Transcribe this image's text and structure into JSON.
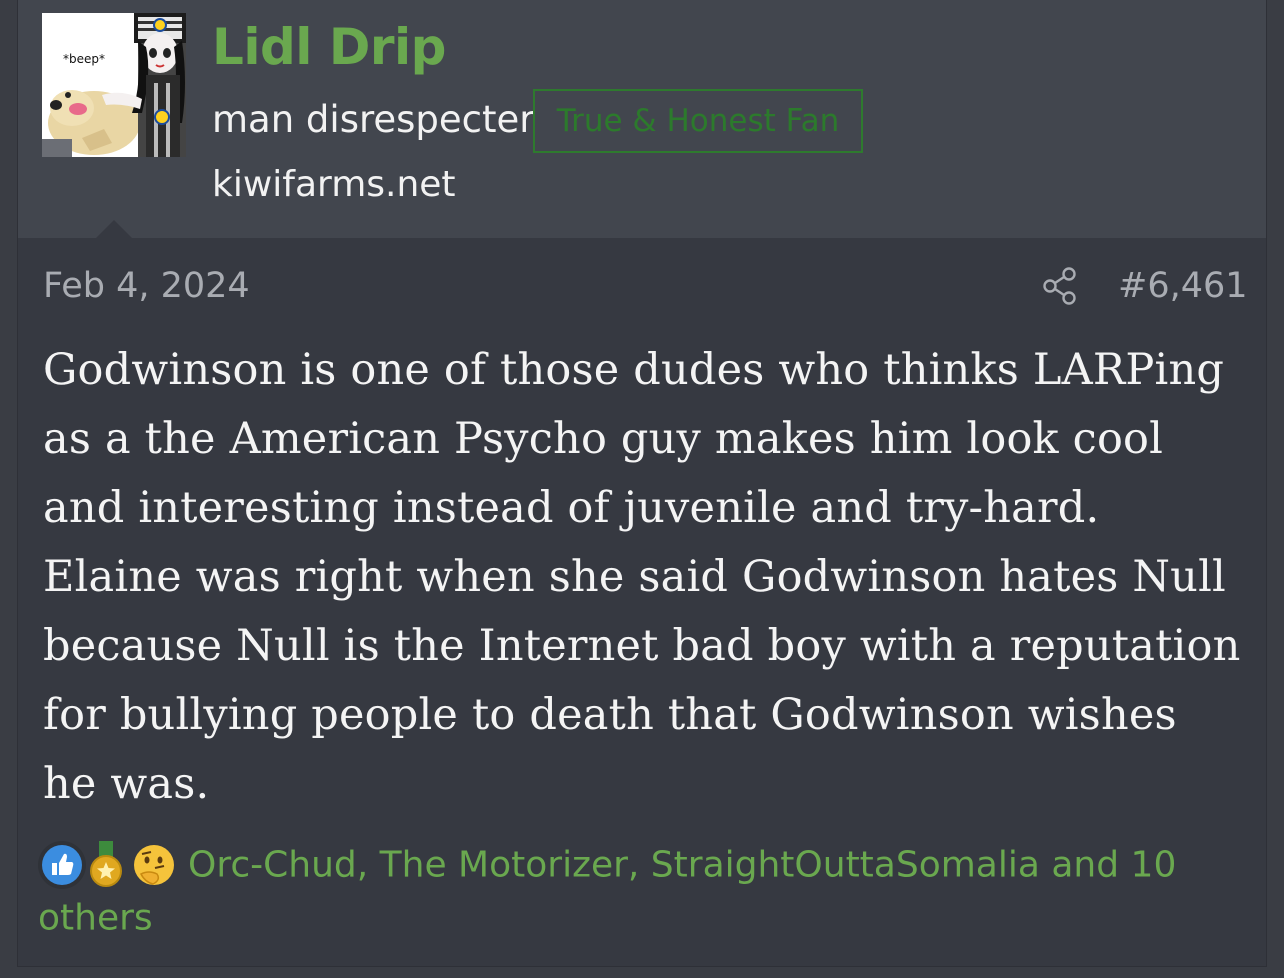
{
  "user": {
    "name": "Lidl Drip",
    "title": "man disrespecter",
    "banner": "True & Honest Fan",
    "site": "kiwifarms.net",
    "avatar_caption": "*beep*"
  },
  "post": {
    "date": "Feb 4, 2024",
    "number": "#6,461",
    "body": "Godwinson is one of those dudes who thinks LARPing as a the American Psycho guy makes him look cool and interesting instead of juvenile and try-hard. Elaine was right when she said Godwinson hates Null because Null is the Internet bad boy with a reputation for bullying people to death that Godwinson wishes he was."
  },
  "reactions": {
    "icons": [
      "like-icon",
      "medal-icon",
      "thinking-icon"
    ],
    "summary": "Orc-Chud, The Motorizer, StraightOuttaSomalia and 10 others"
  },
  "colors": {
    "username": "#6aa84f",
    "banner": "#2c7a2c",
    "user_block_bg": "#42464e",
    "post_bg": "#363941",
    "text": "#f4f4f4",
    "muted": "#a9acb2"
  }
}
